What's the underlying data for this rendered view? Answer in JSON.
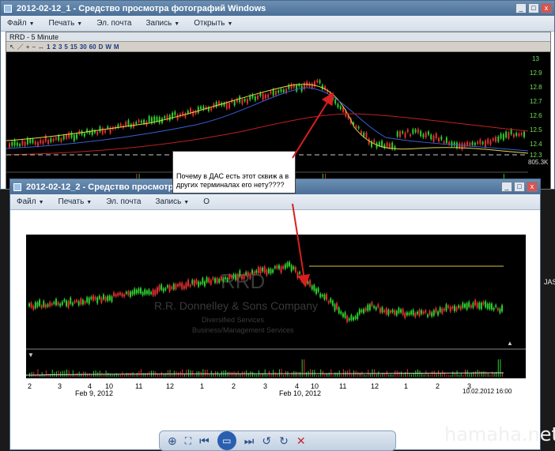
{
  "window1": {
    "title": "2012-02-12_1 - Средство просмотра фотографий Windows",
    "menu": [
      "Файл",
      "Печать",
      "Эл. почта",
      "Запись",
      "Открыть"
    ]
  },
  "chart1": {
    "window_title": "RRD - 5 Minute",
    "periods": [
      "1",
      "2",
      "3",
      "5",
      "15",
      "30",
      "60",
      "D",
      "W"
    ],
    "price_ticks": [
      "13",
      "12.9",
      "12.8",
      "12.7",
      "12.6",
      "12.5",
      "12.4",
      "12.3"
    ],
    "volume_label": "805.3K"
  },
  "window2": {
    "title": "2012-02-12_2 - Средство просмотра фотограф",
    "menu": [
      "Файл",
      "Печать",
      "Эл. почта",
      "Запись",
      "О"
    ]
  },
  "note": {
    "text": "Почему в ДАС есть этот сквиж а в других терминалах его нету????"
  },
  "chart2": {
    "symbol": "RRD",
    "company": "R.R. Donnelley & Sons Company",
    "sector": "Diversified Services",
    "industry": "Business/Management Services",
    "x_ticks": [
      "2",
      "3",
      "4",
      "10",
      "11",
      "12",
      "1",
      "2",
      "3",
      "4",
      "10",
      "11",
      "12",
      "1",
      "2",
      "3"
    ],
    "date_labels": [
      "Feb 9, 2012",
      "Feb 10, 2012"
    ],
    "timestamp": "10.02.2012 16:00"
  },
  "side_label": "JAS",
  "watermark": "hamaha.net",
  "colors": {
    "candle_up": "#2ecc2e",
    "candle_down": "#e03030",
    "titlebar": "#4a6f97",
    "arrow": "#d81f1f"
  }
}
